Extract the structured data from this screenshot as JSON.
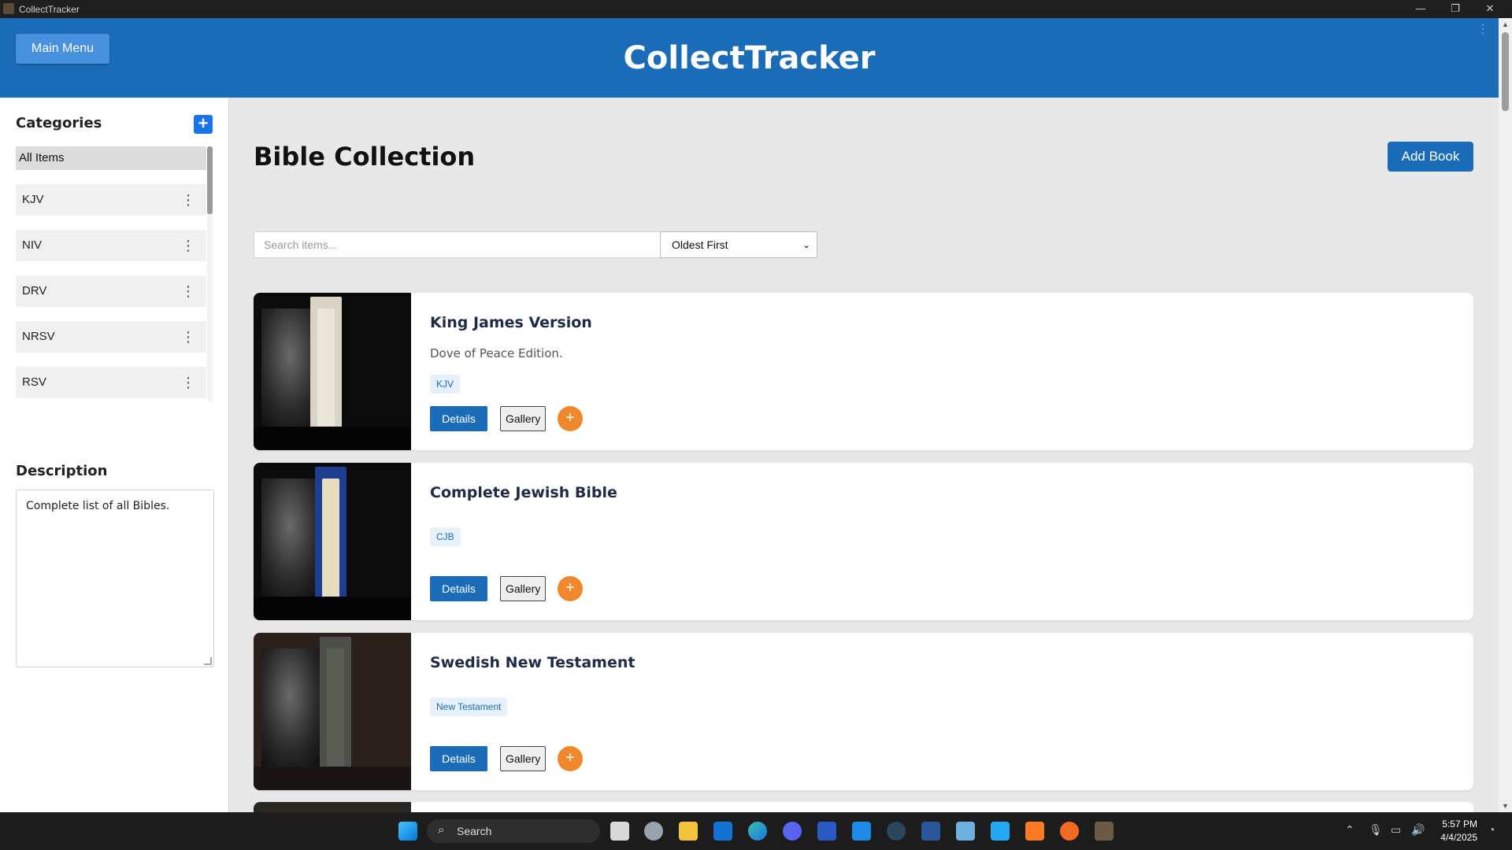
{
  "window": {
    "title": "CollectTracker",
    "minimize": "—",
    "restore": "❐",
    "close": "✕"
  },
  "header": {
    "menu_label": "Main Menu",
    "app_title": "CollectTracker",
    "kebab": "⋮"
  },
  "sidebar": {
    "categories_heading": "Categories",
    "add_icon": "+",
    "all_items": "All Items",
    "items": [
      {
        "label": "KJV"
      },
      {
        "label": "NIV"
      },
      {
        "label": "DRV"
      },
      {
        "label": "NRSV"
      },
      {
        "label": "RSV"
      }
    ],
    "item_menu_icon": "⋮",
    "description_heading": "Description",
    "description": "Complete list of all Bibles."
  },
  "main": {
    "title": "Bible Collection",
    "add_book_label": "Add Book",
    "search_placeholder": "Search items...",
    "sort_selected": "Oldest First",
    "sort_chevron": "⌄"
  },
  "cards": [
    {
      "name": "King James Version",
      "subtitle": "Dove of Peace Edition.",
      "tag": "KJV",
      "details": "Details",
      "gallery": "Gallery",
      "add": "+"
    },
    {
      "name": "Complete Jewish Bible",
      "subtitle": "",
      "tag": "CJB",
      "details": "Details",
      "gallery": "Gallery",
      "add": "+"
    },
    {
      "name": "Swedish New Testament",
      "subtitle": "",
      "tag": "New Testament",
      "details": "Details",
      "gallery": "Gallery",
      "add": "+"
    }
  ],
  "colors": {
    "header": "#1a6cb8",
    "accent_orange": "#f0882b",
    "add_category": "#1a73e8"
  },
  "taskbar": {
    "search_label": "Search",
    "time": "5:57 PM",
    "date": "4/4/2025",
    "icons": [
      "windows-start-icon",
      "task-view-icon",
      "settings-icon",
      "file-explorer-icon",
      "outlook-icon",
      "edge-icon",
      "discord-icon",
      "photos-icon",
      "bing-icon",
      "steam-icon",
      "word-icon",
      "notepad-icon",
      "vscode-icon",
      "xampp-icon",
      "pencil-app-icon",
      "collecttracker-icon"
    ]
  }
}
